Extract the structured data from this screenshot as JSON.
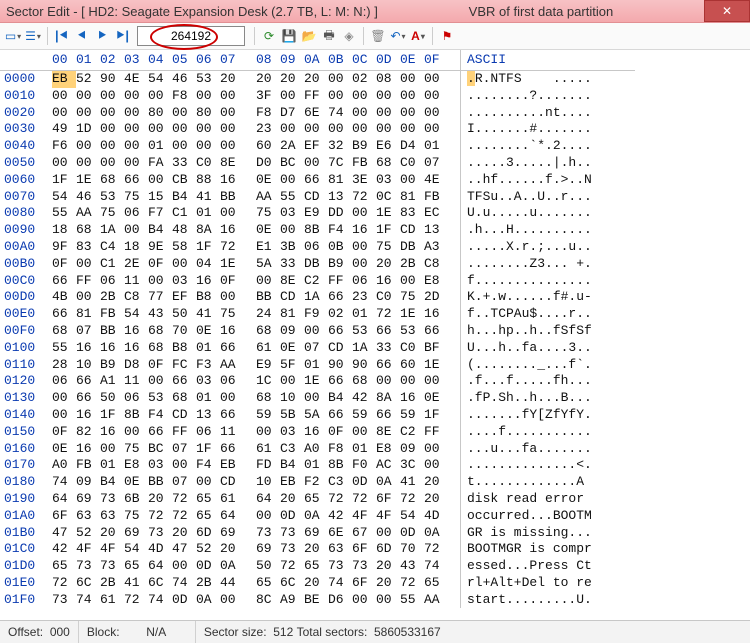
{
  "titlebar": {
    "title": "Sector Edit - [ HD2: Seagate Expansion Desk (2.7 TB, L: M: N:) ]",
    "subtitle": "VBR of first data partition"
  },
  "toolbar": {
    "sector_value": "264192"
  },
  "header": {
    "offsets": [
      "00",
      "01",
      "02",
      "03",
      "04",
      "05",
      "06",
      "07",
      "08",
      "09",
      "0A",
      "0B",
      "0C",
      "0D",
      "0E",
      "0F"
    ],
    "ascii_label": "ASCII"
  },
  "rows": [
    {
      "off": "0000",
      "hex": [
        "EB",
        "52",
        "90",
        "4E",
        "54",
        "46",
        "53",
        "20",
        "20",
        "20",
        "20",
        "00",
        "02",
        "08",
        "00",
        "00"
      ],
      "asc": ".R.NTFS    ....."
    },
    {
      "off": "0010",
      "hex": [
        "00",
        "00",
        "00",
        "00",
        "00",
        "F8",
        "00",
        "00",
        "3F",
        "00",
        "FF",
        "00",
        "00",
        "00",
        "00",
        "00"
      ],
      "asc": "........?......."
    },
    {
      "off": "0020",
      "hex": [
        "00",
        "00",
        "00",
        "00",
        "80",
        "00",
        "80",
        "00",
        "F8",
        "D7",
        "6E",
        "74",
        "00",
        "00",
        "00",
        "00"
      ],
      "asc": "..........nt...."
    },
    {
      "off": "0030",
      "hex": [
        "49",
        "1D",
        "00",
        "00",
        "00",
        "00",
        "00",
        "00",
        "23",
        "00",
        "00",
        "00",
        "00",
        "00",
        "00",
        "00"
      ],
      "asc": "I.......#......."
    },
    {
      "off": "0040",
      "hex": [
        "F6",
        "00",
        "00",
        "00",
        "01",
        "00",
        "00",
        "00",
        "60",
        "2A",
        "EF",
        "32",
        "B9",
        "E6",
        "D4",
        "01"
      ],
      "asc": "........`*.2...."
    },
    {
      "off": "0050",
      "hex": [
        "00",
        "00",
        "00",
        "00",
        "FA",
        "33",
        "C0",
        "8E",
        "D0",
        "BC",
        "00",
        "7C",
        "FB",
        "68",
        "C0",
        "07"
      ],
      "asc": ".....3.....|.h.."
    },
    {
      "off": "0060",
      "hex": [
        "1F",
        "1E",
        "68",
        "66",
        "00",
        "CB",
        "88",
        "16",
        "0E",
        "00",
        "66",
        "81",
        "3E",
        "03",
        "00",
        "4E"
      ],
      "asc": "..hf......f.>..N"
    },
    {
      "off": "0070",
      "hex": [
        "54",
        "46",
        "53",
        "75",
        "15",
        "B4",
        "41",
        "BB",
        "AA",
        "55",
        "CD",
        "13",
        "72",
        "0C",
        "81",
        "FB"
      ],
      "asc": "TFSu..A..U..r..."
    },
    {
      "off": "0080",
      "hex": [
        "55",
        "AA",
        "75",
        "06",
        "F7",
        "C1",
        "01",
        "00",
        "75",
        "03",
        "E9",
        "DD",
        "00",
        "1E",
        "83",
        "EC"
      ],
      "asc": "U.u.....u......."
    },
    {
      "off": "0090",
      "hex": [
        "18",
        "68",
        "1A",
        "00",
        "B4",
        "48",
        "8A",
        "16",
        "0E",
        "00",
        "8B",
        "F4",
        "16",
        "1F",
        "CD",
        "13"
      ],
      "asc": ".h...H.........."
    },
    {
      "off": "00A0",
      "hex": [
        "9F",
        "83",
        "C4",
        "18",
        "9E",
        "58",
        "1F",
        "72",
        "E1",
        "3B",
        "06",
        "0B",
        "00",
        "75",
        "DB",
        "A3"
      ],
      "asc": ".....X.r.;...u.."
    },
    {
      "off": "00B0",
      "hex": [
        "0F",
        "00",
        "C1",
        "2E",
        "0F",
        "00",
        "04",
        "1E",
        "5A",
        "33",
        "DB",
        "B9",
        "00",
        "20",
        "2B",
        "C8"
      ],
      "asc": "........Z3... +."
    },
    {
      "off": "00C0",
      "hex": [
        "66",
        "FF",
        "06",
        "11",
        "00",
        "03",
        "16",
        "0F",
        "00",
        "8E",
        "C2",
        "FF",
        "06",
        "16",
        "00",
        "E8"
      ],
      "asc": "f..............."
    },
    {
      "off": "00D0",
      "hex": [
        "4B",
        "00",
        "2B",
        "C8",
        "77",
        "EF",
        "B8",
        "00",
        "BB",
        "CD",
        "1A",
        "66",
        "23",
        "C0",
        "75",
        "2D"
      ],
      "asc": "K.+.w......f#.u-"
    },
    {
      "off": "00E0",
      "hex": [
        "66",
        "81",
        "FB",
        "54",
        "43",
        "50",
        "41",
        "75",
        "24",
        "81",
        "F9",
        "02",
        "01",
        "72",
        "1E",
        "16"
      ],
      "asc": "f..TCPAu$....r.."
    },
    {
      "off": "00F0",
      "hex": [
        "68",
        "07",
        "BB",
        "16",
        "68",
        "70",
        "0E",
        "16",
        "68",
        "09",
        "00",
        "66",
        "53",
        "66",
        "53",
        "66"
      ],
      "asc": "h...hp..h..fSfSf"
    },
    {
      "off": "0100",
      "hex": [
        "55",
        "16",
        "16",
        "16",
        "68",
        "B8",
        "01",
        "66",
        "61",
        "0E",
        "07",
        "CD",
        "1A",
        "33",
        "C0",
        "BF"
      ],
      "asc": "U...h..fa....3.."
    },
    {
      "off": "0110",
      "hex": [
        "28",
        "10",
        "B9",
        "D8",
        "0F",
        "FC",
        "F3",
        "AA",
        "E9",
        "5F",
        "01",
        "90",
        "90",
        "66",
        "60",
        "1E"
      ],
      "asc": "(........_...f`."
    },
    {
      "off": "0120",
      "hex": [
        "06",
        "66",
        "A1",
        "11",
        "00",
        "66",
        "03",
        "06",
        "1C",
        "00",
        "1E",
        "66",
        "68",
        "00",
        "00",
        "00"
      ],
      "asc": ".f...f.....fh..."
    },
    {
      "off": "0130",
      "hex": [
        "00",
        "66",
        "50",
        "06",
        "53",
        "68",
        "01",
        "00",
        "68",
        "10",
        "00",
        "B4",
        "42",
        "8A",
        "16",
        "0E"
      ],
      "asc": ".fP.Sh..h...B..."
    },
    {
      "off": "0140",
      "hex": [
        "00",
        "16",
        "1F",
        "8B",
        "F4",
        "CD",
        "13",
        "66",
        "59",
        "5B",
        "5A",
        "66",
        "59",
        "66",
        "59",
        "1F"
      ],
      "asc": ".......fY[ZfYfY."
    },
    {
      "off": "0150",
      "hex": [
        "0F",
        "82",
        "16",
        "00",
        "66",
        "FF",
        "06",
        "11",
        "00",
        "03",
        "16",
        "0F",
        "00",
        "8E",
        "C2",
        "FF"
      ],
      "asc": "....f..........."
    },
    {
      "off": "0160",
      "hex": [
        "0E",
        "16",
        "00",
        "75",
        "BC",
        "07",
        "1F",
        "66",
        "61",
        "C3",
        "A0",
        "F8",
        "01",
        "E8",
        "09",
        "00"
      ],
      "asc": "...u...fa......."
    },
    {
      "off": "0170",
      "hex": [
        "A0",
        "FB",
        "01",
        "E8",
        "03",
        "00",
        "F4",
        "EB",
        "FD",
        "B4",
        "01",
        "8B",
        "F0",
        "AC",
        "3C",
        "00"
      ],
      "asc": "..............<."
    },
    {
      "off": "0180",
      "hex": [
        "74",
        "09",
        "B4",
        "0E",
        "BB",
        "07",
        "00",
        "CD",
        "10",
        "EB",
        "F2",
        "C3",
        "0D",
        "0A",
        "41",
        "20"
      ],
      "asc": "t.............A "
    },
    {
      "off": "0190",
      "hex": [
        "64",
        "69",
        "73",
        "6B",
        "20",
        "72",
        "65",
        "61",
        "64",
        "20",
        "65",
        "72",
        "72",
        "6F",
        "72",
        "20"
      ],
      "asc": "disk read error "
    },
    {
      "off": "01A0",
      "hex": [
        "6F",
        "63",
        "63",
        "75",
        "72",
        "72",
        "65",
        "64",
        "00",
        "0D",
        "0A",
        "42",
        "4F",
        "4F",
        "54",
        "4D"
      ],
      "asc": "occurred...BOOTM"
    },
    {
      "off": "01B0",
      "hex": [
        "47",
        "52",
        "20",
        "69",
        "73",
        "20",
        "6D",
        "69",
        "73",
        "73",
        "69",
        "6E",
        "67",
        "00",
        "0D",
        "0A"
      ],
      "asc": "GR is missing..."
    },
    {
      "off": "01C0",
      "hex": [
        "42",
        "4F",
        "4F",
        "54",
        "4D",
        "47",
        "52",
        "20",
        "69",
        "73",
        "20",
        "63",
        "6F",
        "6D",
        "70",
        "72"
      ],
      "asc": "BOOTMGR is compr"
    },
    {
      "off": "01D0",
      "hex": [
        "65",
        "73",
        "73",
        "65",
        "64",
        "00",
        "0D",
        "0A",
        "50",
        "72",
        "65",
        "73",
        "73",
        "20",
        "43",
        "74"
      ],
      "asc": "essed...Press Ct"
    },
    {
      "off": "01E0",
      "hex": [
        "72",
        "6C",
        "2B",
        "41",
        "6C",
        "74",
        "2B",
        "44",
        "65",
        "6C",
        "20",
        "74",
        "6F",
        "20",
        "72",
        "65"
      ],
      "asc": "rl+Alt+Del to re"
    },
    {
      "off": "01F0",
      "hex": [
        "73",
        "74",
        "61",
        "72",
        "74",
        "0D",
        "0A",
        "00",
        "8C",
        "A9",
        "BE",
        "D6",
        "00",
        "00",
        "55",
        "AA"
      ],
      "asc": "start.........U."
    }
  ],
  "status": {
    "offset_label": "Offset:",
    "offset_value": "000",
    "block_label": "Block:",
    "block_value": "N/A",
    "sector_size_label": "Sector size:",
    "sector_size_value": "512",
    "total_sectors_label": "Total sectors:",
    "total_sectors_value": "5860533167"
  }
}
